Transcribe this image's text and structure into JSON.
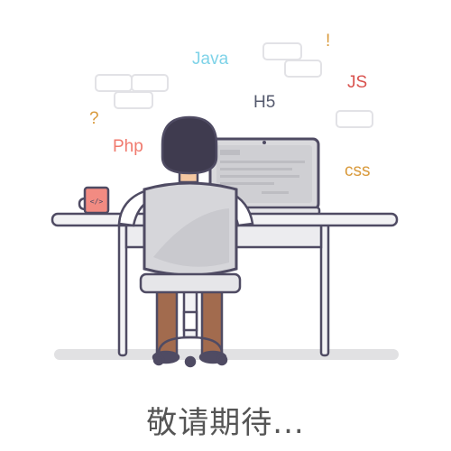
{
  "caption": "敬请期待...",
  "words": {
    "java": "Java",
    "js": "JS",
    "h5": "H5",
    "php": "Php",
    "css": "css",
    "question": "?",
    "exclamation": "!"
  },
  "colors": {
    "java": "#7fd3e8",
    "js": "#d9534f",
    "h5": "#555a6e",
    "php": "#f07a6e",
    "css": "#d99a3c",
    "question": "#d99a3c",
    "exclamation": "#d99a3c",
    "caption": "#555555",
    "outline": "#4f4b63"
  },
  "icons": {
    "mug": "mug-icon",
    "mug_label": "</>"
  }
}
